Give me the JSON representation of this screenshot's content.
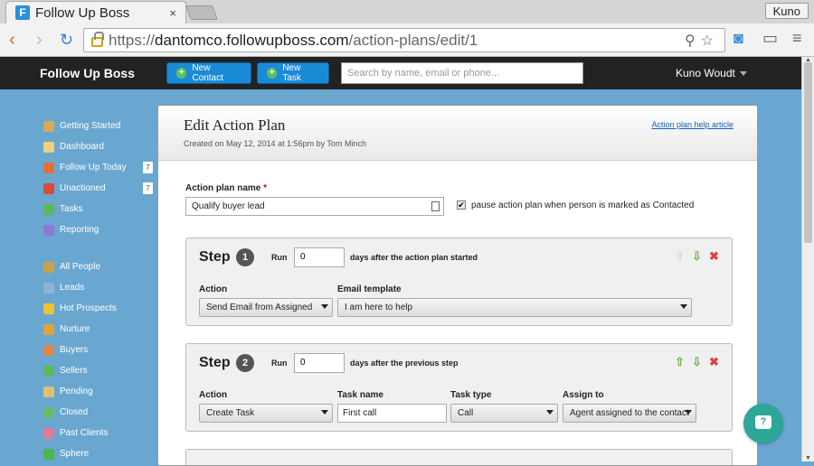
{
  "browser": {
    "tab_title": "Follow Up Boss",
    "tab_close": "×",
    "profile_name": "Kuno",
    "url_prefix": "https://",
    "url_host": "dantomco.followupboss.com",
    "url_path": "/action-plans/edit/1"
  },
  "appbar": {
    "brand": "Follow Up Boss",
    "new_contact": "New Contact",
    "new_task": "New Task",
    "search_placeholder": "Search by name, email or phone...",
    "user": "Kuno Woudt"
  },
  "sidebar": {
    "top": [
      {
        "label": "Getting Started",
        "icon": "house-icon",
        "color": "#d9a85a"
      },
      {
        "label": "Dashboard",
        "icon": "dashboard-icon",
        "color": "#f1d07a"
      },
      {
        "label": "Follow Up Today",
        "icon": "clock-icon",
        "color": "#e2703a",
        "count": "7"
      },
      {
        "label": "Unactioned",
        "icon": "pin-icon",
        "color": "#d94d3a",
        "count": "7"
      },
      {
        "label": "Tasks",
        "icon": "check-icon",
        "color": "#5cb85c"
      },
      {
        "label": "Reporting",
        "icon": "chart-icon",
        "color": "#8a7ad8"
      }
    ],
    "bottom": [
      {
        "label": "All People",
        "icon": "book-icon",
        "color": "#c7a24a"
      },
      {
        "label": "Leads",
        "icon": "card-icon",
        "color": "#8fb0d8"
      },
      {
        "label": "Hot Prospects",
        "icon": "star-icon",
        "color": "#f2c230"
      },
      {
        "label": "Nurture",
        "icon": "gift-icon",
        "color": "#e2a23a"
      },
      {
        "label": "Buyers",
        "icon": "buyer-icon",
        "color": "#d98a4a"
      },
      {
        "label": "Sellers",
        "icon": "house-icon",
        "color": "#5cb85c"
      },
      {
        "label": "Pending",
        "icon": "note-icon",
        "color": "#e0c070"
      },
      {
        "label": "Closed",
        "icon": "money-icon",
        "color": "#6ab86a"
      },
      {
        "label": "Past Clients",
        "icon": "heart-icon",
        "color": "#e27a9a"
      },
      {
        "label": "Sphere",
        "icon": "globe-icon",
        "color": "#4ab84a"
      }
    ]
  },
  "panel": {
    "title": "Edit Action Plan",
    "subtitle": "Created on May 12, 2014 at 1:56pm by Tom Minch",
    "help_link": "Action plan help article",
    "name_label": "Action plan name",
    "required_mark": "*",
    "name_value": "Qualify buyer lead",
    "pause_checked": "✔",
    "pause_label": "pause action plan when person is marked as Contacted"
  },
  "steps": [
    {
      "word": "Step",
      "number": "1",
      "run_label": "Run",
      "run_value": "0",
      "days_label": "days after the action plan started",
      "action_label": "Action",
      "action_value": "Send Email from Assigned",
      "email_label": "Email template",
      "email_value": "I am here to help"
    },
    {
      "word": "Step",
      "number": "2",
      "run_label": "Run",
      "run_value": "0",
      "days_label": "days after the previous step",
      "action_label": "Action",
      "action_value": "Create Task",
      "taskname_label": "Task name",
      "taskname_value": "First call",
      "tasktype_label": "Task type",
      "tasktype_value": "Call",
      "assign_label": "Assign to",
      "assign_value": "Agent assigned to the contact"
    }
  ],
  "controls": {
    "up": "⇧",
    "down": "⇩",
    "delete": "✖"
  },
  "colors": {
    "accent": "#1b8bd8",
    "sidebar_bg": "#6aa7d0",
    "chat": "#2da797"
  }
}
